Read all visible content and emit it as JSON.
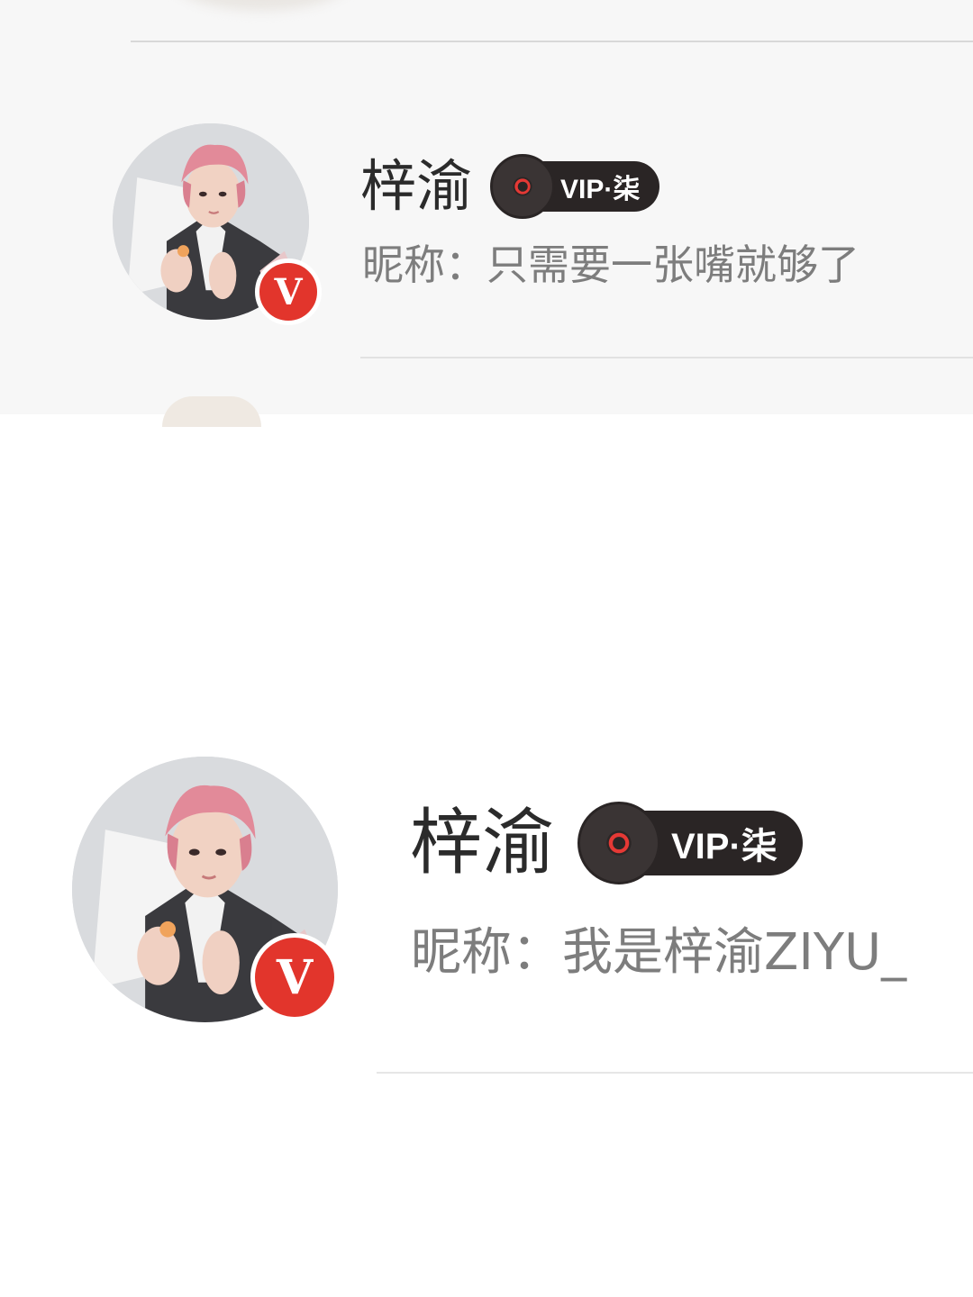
{
  "profiles": [
    {
      "name": "梓渝",
      "vip_label": "VIP·柒",
      "nickname_label": "昵称：",
      "nickname_value": "只需要一张嘴就够了",
      "verified_badge": "V"
    },
    {
      "name": "梓渝",
      "vip_label": "VIP·柒",
      "nickname_label": "昵称：",
      "nickname_value": "我是梓渝ZIYU_",
      "verified_badge": "V"
    }
  ],
  "icons": {
    "vip_disc": "vinyl-record-icon",
    "verified": "verified-v-icon"
  },
  "colors": {
    "name_text": "#2b2b2b",
    "nickname_text": "#7d7d7d",
    "vip_pill_bg": "#2a2525",
    "verified_badge_bg": "#e2352c",
    "disc_center": "#e53935"
  }
}
